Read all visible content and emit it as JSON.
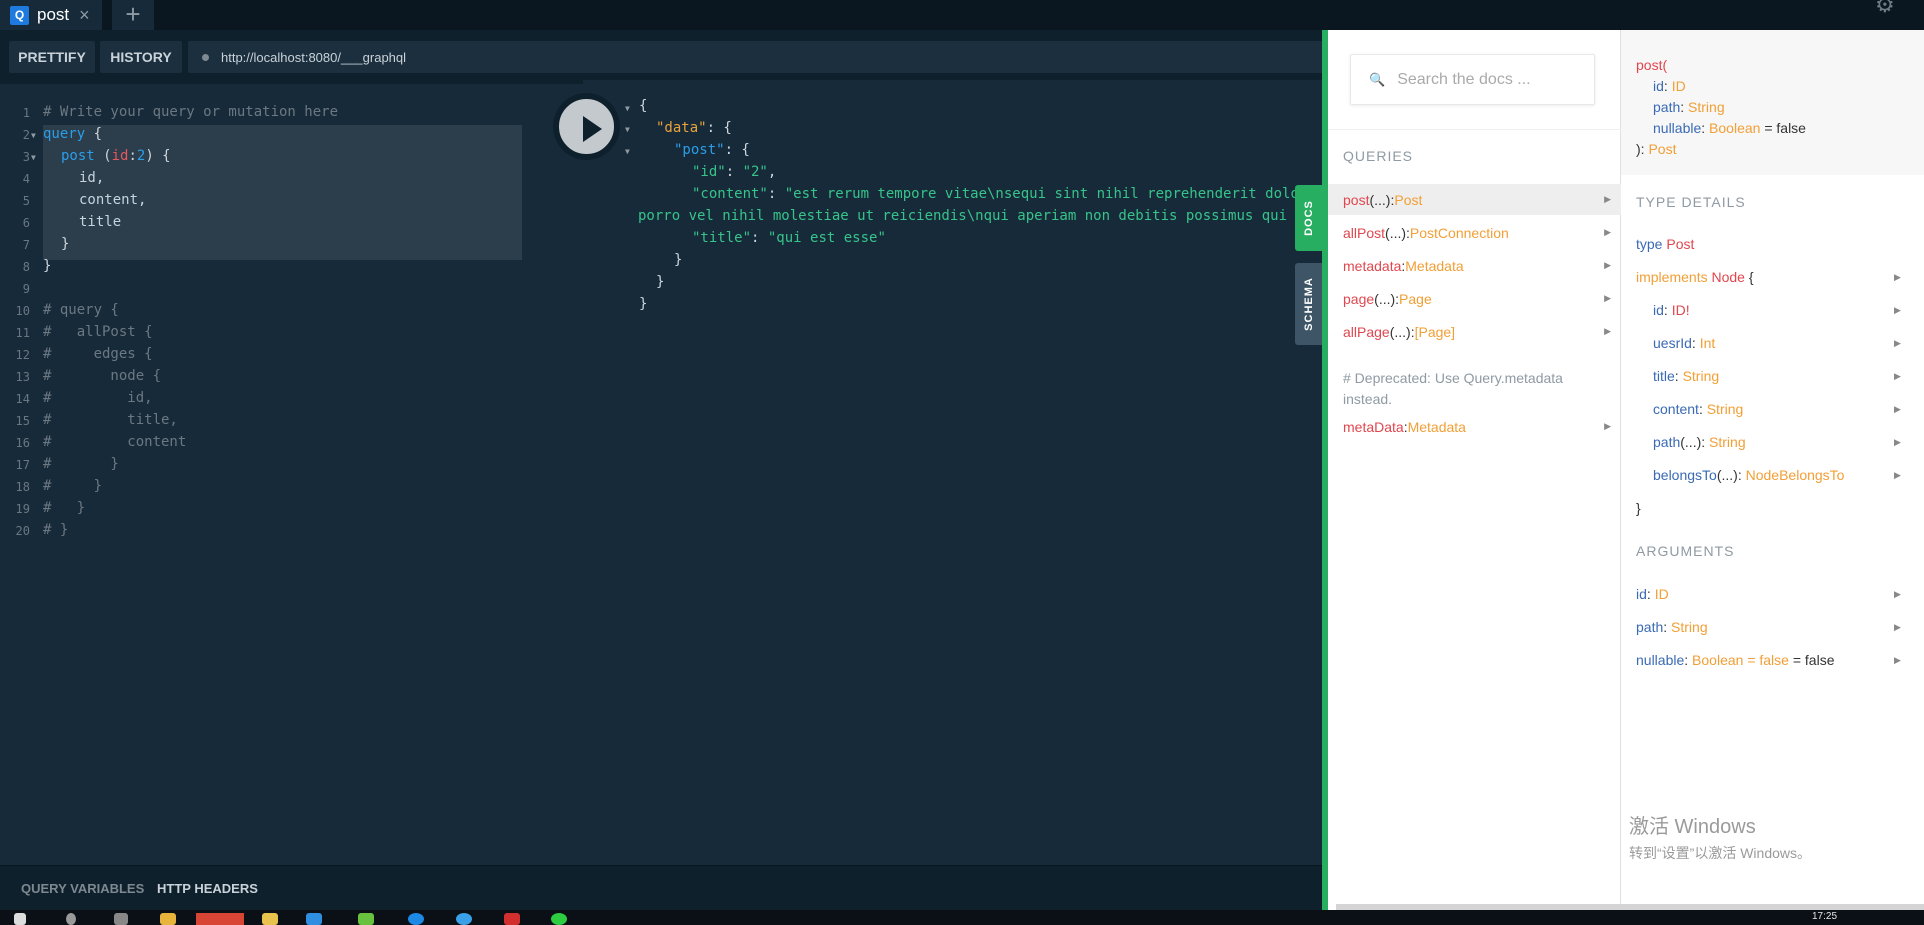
{
  "tab": {
    "icon": "Q",
    "title": "post",
    "close": "×",
    "new": "+"
  },
  "toolbar": {
    "prettify": "PRETTIFY",
    "history": "HISTORY",
    "url": "http://localhost:8080/___graphql"
  },
  "editor": {
    "line_numbers": [
      "1",
      "2",
      "3",
      "4",
      "5",
      "6",
      "7",
      "8",
      "9",
      "10",
      "11",
      "12",
      "13",
      "14",
      "15",
      "16",
      "17",
      "18",
      "19",
      "20"
    ],
    "comment1": "# Write your query or mutation here",
    "query_kw": "query",
    "brace_open": " {",
    "post_field": "post",
    "paren_open": " (",
    "arg_name": "id",
    "colon": ":",
    "arg_value": "2",
    "paren_close_brace": ") {",
    "f_id": "id,",
    "f_content": "content,",
    "f_title": "title",
    "close_inner": "}",
    "close_outer": "}",
    "c10": "# query {",
    "c11": "#   allPost {",
    "c12": "#     edges {",
    "c13": "#       node {",
    "c14": "#         id,",
    "c15": "#         title,",
    "c16": "#         content",
    "c17": "#       }",
    "c18": "#     }",
    "c19": "#   }",
    "c20": "# }"
  },
  "result": {
    "l1": "{",
    "data_key": "\"data\"",
    "post_key": "\"post\"",
    "id_key": "\"id\"",
    "id_val": "\"2\"",
    "content_key": "\"content\"",
    "content_val1": "\"est rerum tempore vitae\\nsequi sint nihil reprehenderit dolor beatae ea dolores neque\\nfugiat blanditiis voluptate",
    "content_val2": "porro vel nihil molestiae ut reiciendis\\nqui aperiam non debitis possimus qui neque nisi nulla\"",
    "title_key": "\"title\"",
    "title_val": "\"qui est esse\"",
    "colon_brace": ": {",
    "colon": ": ",
    "comma": ",",
    "close1": "}",
    "close2": "}",
    "close3": "}"
  },
  "bottom": {
    "vars": "QUERY VARIABLES",
    "headers": "HTTP HEADERS"
  },
  "side_tabs": {
    "docs": "DOCS",
    "schema": "SCHEMA"
  },
  "docs": {
    "search_placeholder": "Search the docs ...",
    "queries_label": "QUERIES",
    "queries": [
      {
        "name": "post",
        "args": "(...)",
        "sep": ": ",
        "type": "Post"
      },
      {
        "name": "allPost",
        "args": "(...)",
        "sep": ": ",
        "type": "PostConnection"
      },
      {
        "name": "metadata",
        "args": "",
        "sep": ": ",
        "type": "Metadata"
      },
      {
        "name": "page",
        "args": "(...)",
        "sep": ": ",
        "type": "Page"
      },
      {
        "name": "allPage",
        "args": "(...)",
        "sep": ": ",
        "type": "[Page]"
      }
    ],
    "deprecated_note": "# Deprecated: Use Query.metadata instead.",
    "deprecated_item": {
      "name": "metaData",
      "sep": ": ",
      "type": "Metadata"
    }
  },
  "detail": {
    "sig_name": "post(",
    "sig_args": [
      {
        "name": "id",
        "type": "ID",
        "default": ""
      },
      {
        "name": "path",
        "type": "String",
        "default": ""
      },
      {
        "name": "nullable",
        "type": "Boolean",
        "default": " = false"
      }
    ],
    "sig_close": "): ",
    "sig_ret": "Post",
    "type_details_label": "TYPE DETAILS",
    "type_kw": "type ",
    "type_name": "Post",
    "implements_kw": "implements ",
    "implements_name": "Node",
    "brace": " {",
    "fields": [
      {
        "name": "id",
        "args": "",
        "type": "ID!"
      },
      {
        "name": "uesrId",
        "args": "",
        "type": "Int"
      },
      {
        "name": "title",
        "args": "",
        "type": "String"
      },
      {
        "name": "content",
        "args": "",
        "type": "String"
      },
      {
        "name": "path",
        "args": "(...)",
        "type": "String"
      },
      {
        "name": "belongsTo",
        "args": "(...)",
        "type": "NodeBelongsTo"
      }
    ],
    "close_brace": "}",
    "arguments_label": "ARGUMENTS",
    "arguments": [
      {
        "name": "id",
        "type": "ID",
        "extra": ""
      },
      {
        "name": "path",
        "type": "String",
        "extra": ""
      },
      {
        "name": "nullable",
        "type": "Boolean = false",
        "extra": " = false"
      }
    ]
  },
  "watermark": {
    "line1": "激活 Windows",
    "line2": "转到“设置”以激活 Windows。"
  },
  "taskbar": {
    "time": "17:25"
  },
  "colors": {
    "accent_green": "#27ae60",
    "field_red": "#e0474f",
    "type_orange": "#f29f36"
  }
}
